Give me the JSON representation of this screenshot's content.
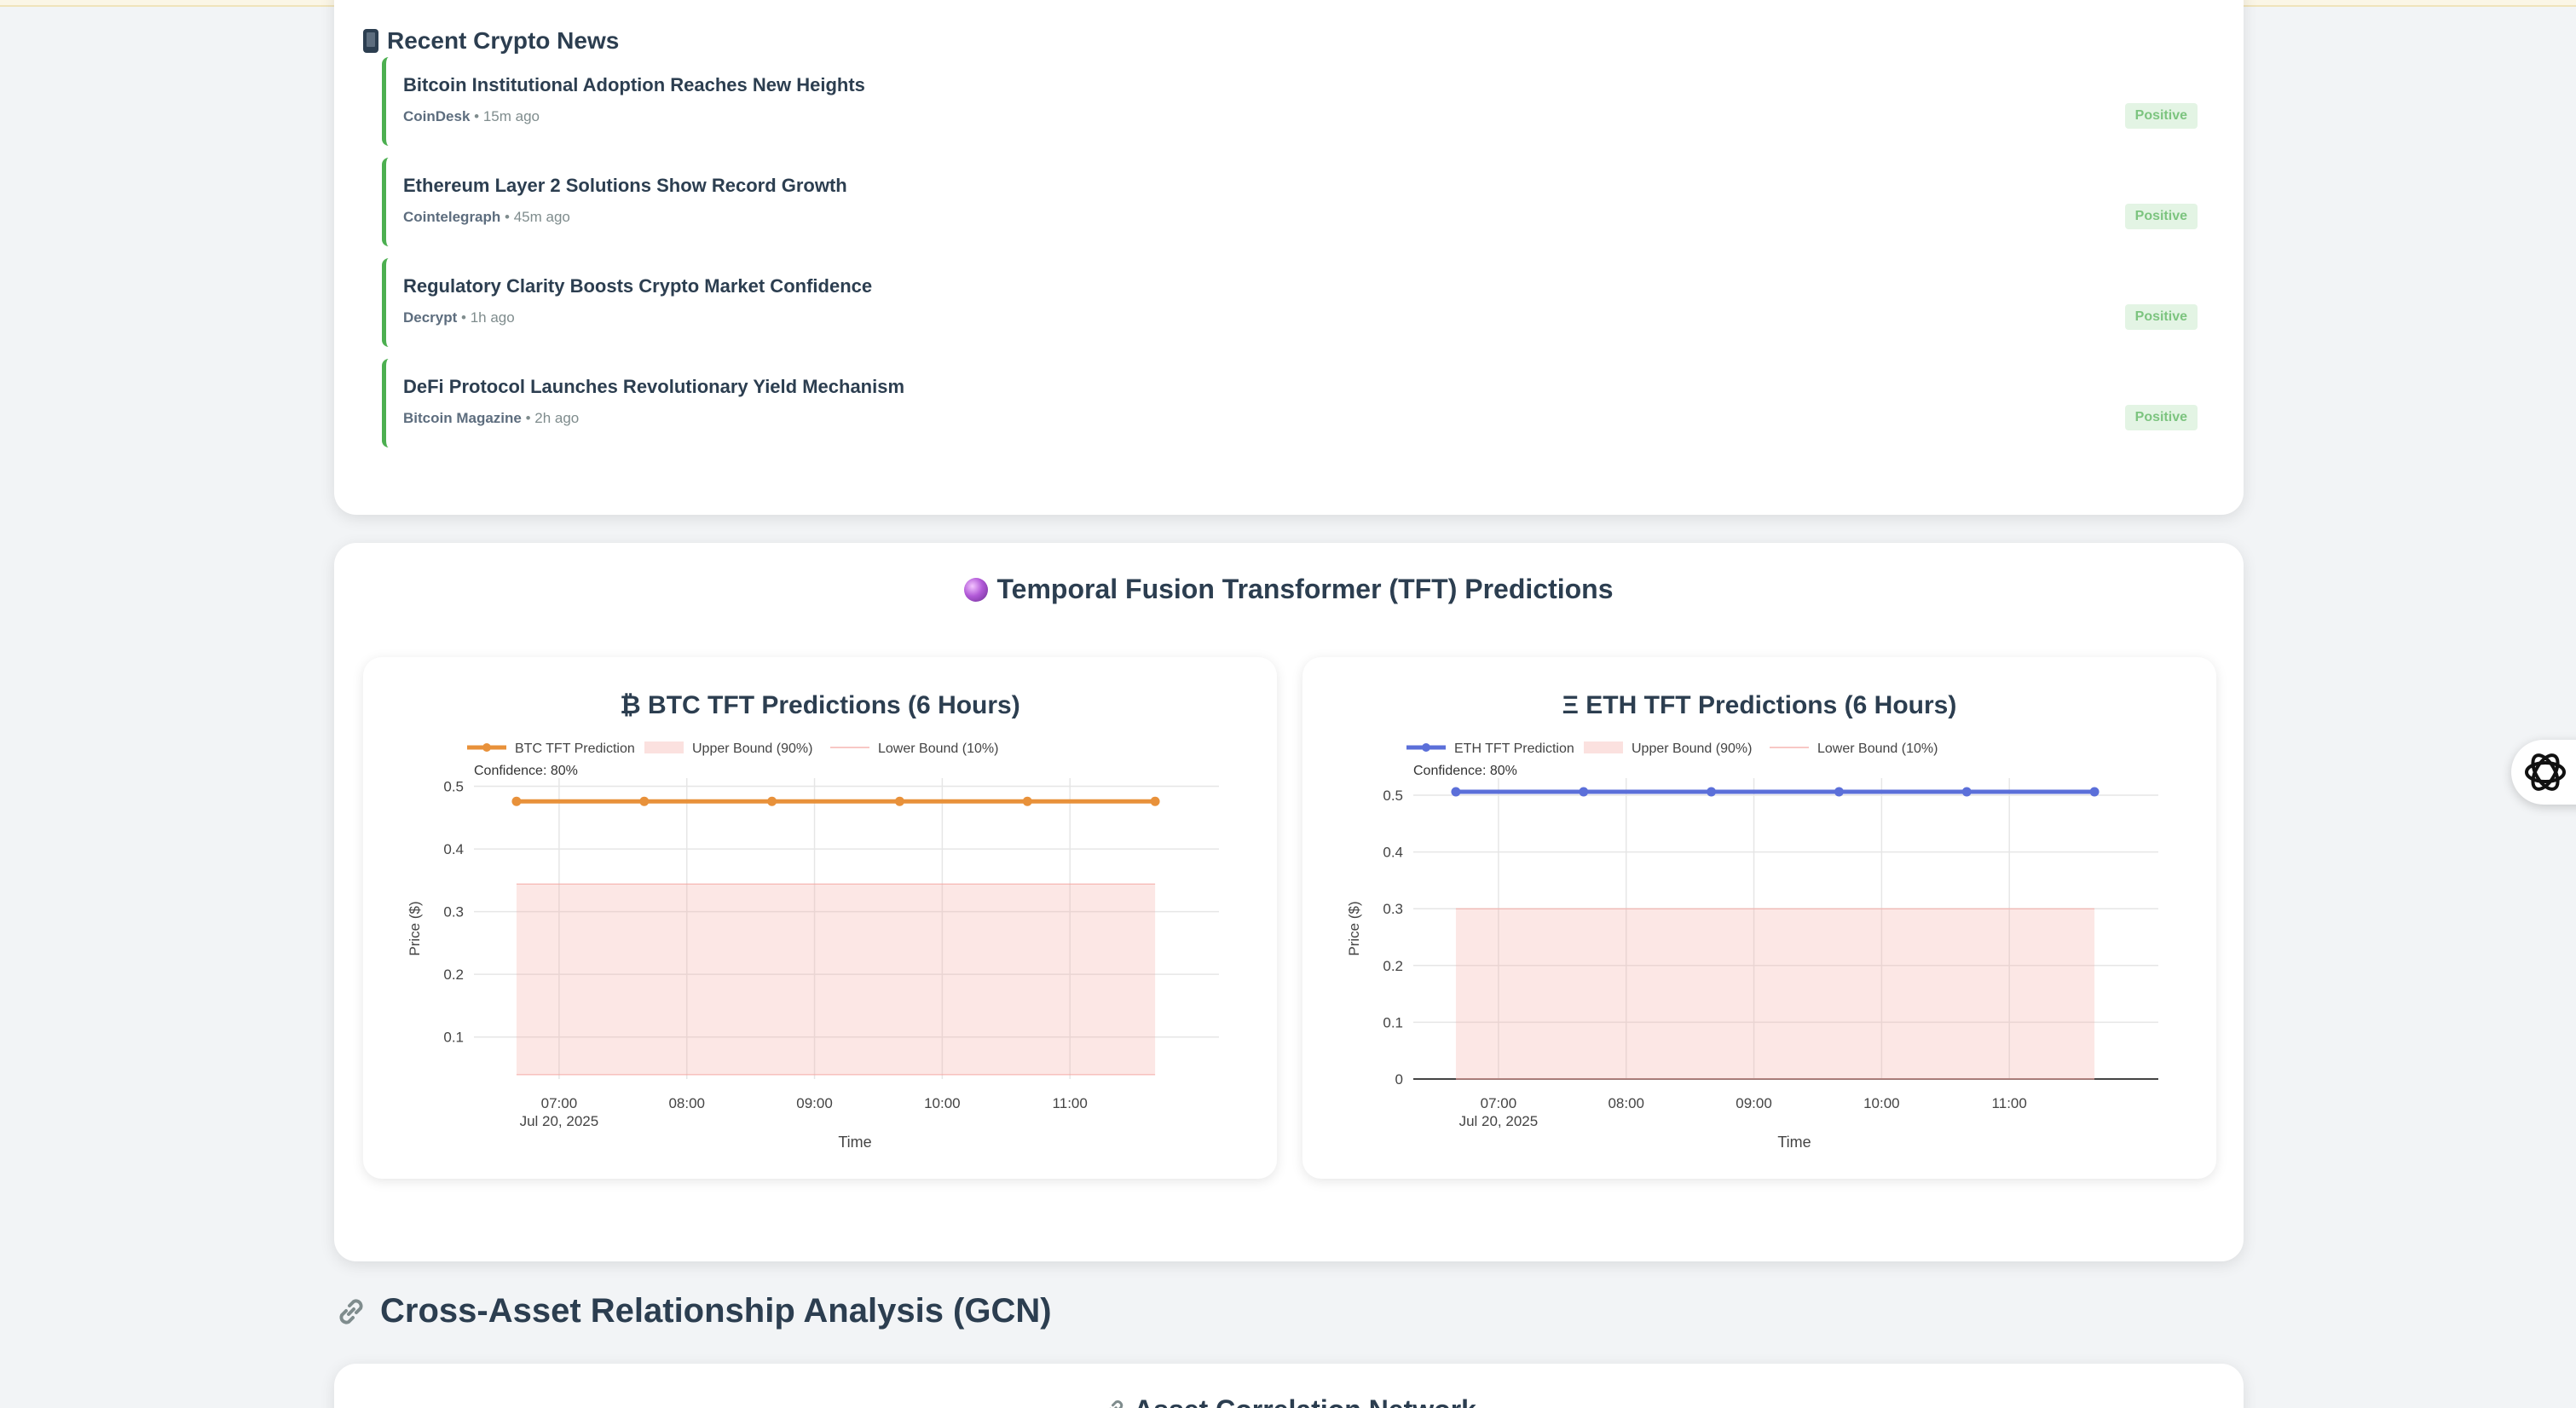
{
  "news": {
    "title": "Recent Crypto News",
    "icon": "phone-icon",
    "accent_color": "#4caf50",
    "items": [
      {
        "headline": "Bitcoin Institutional Adoption Reaches New Heights",
        "source": "CoinDesk",
        "time": "15m ago",
        "sentiment": "Positive"
      },
      {
        "headline": "Ethereum Layer 2 Solutions Show Record Growth",
        "source": "Cointelegraph",
        "time": "45m ago",
        "sentiment": "Positive"
      },
      {
        "headline": "Regulatory Clarity Boosts Crypto Market Confidence",
        "source": "Decrypt",
        "time": "1h ago",
        "sentiment": "Positive"
      },
      {
        "headline": "DeFi Protocol Launches Revolutionary Yield Mechanism",
        "source": "Bitcoin Magazine",
        "time": "2h ago",
        "sentiment": "Positive"
      }
    ]
  },
  "tft": {
    "title": "Temporal Fusion Transformer (TFT) Predictions",
    "icon": "crystal-ball-icon"
  },
  "chart_data": [
    {
      "type": "line",
      "title": "₿ BTC TFT Predictions (6 Hours)",
      "xlabel": "Time",
      "ylabel": "Price ($)",
      "x": [
        "06:40",
        "07:40",
        "08:40",
        "09:40",
        "10:40",
        "11:40"
      ],
      "x_ticks": [
        "07:00",
        "08:00",
        "09:00",
        "10:00",
        "11:00"
      ],
      "x_tick_sub": "Jul 20, 2025",
      "x_range_minutes": [
        -40,
        310
      ],
      "y_ticks": [
        "0.1",
        "0.2",
        "0.3",
        "0.4",
        "0.5"
      ],
      "ylim": [
        0.033,
        0.513
      ],
      "series": [
        {
          "name": "BTC TFT Prediction",
          "values": [
            0.476,
            0.476,
            0.476,
            0.476,
            0.476,
            0.476
          ],
          "color": "#e8913a"
        },
        {
          "name": "Upper Bound (90%)",
          "values": [
            0.344,
            0.344,
            0.344,
            0.344,
            0.344,
            0.344
          ],
          "color": "#f4a8a2"
        },
        {
          "name": "Lower Bound (10%)",
          "values": [
            0.04,
            0.04,
            0.04,
            0.04,
            0.04,
            0.04
          ],
          "color": "#f4a8a2"
        }
      ],
      "annotation": "Confidence: 80%",
      "legend": "top-left",
      "grid": true
    },
    {
      "type": "line",
      "title": "Ξ ETH TFT Predictions (6 Hours)",
      "xlabel": "Time",
      "ylabel": "Price ($)",
      "x": [
        "06:40",
        "07:40",
        "08:40",
        "09:40",
        "10:40",
        "11:40"
      ],
      "x_ticks": [
        "07:00",
        "08:00",
        "09:00",
        "10:00",
        "11:00"
      ],
      "x_tick_sub": "Jul 20, 2025",
      "x_range_minutes": [
        -40,
        310
      ],
      "y_ticks": [
        "0",
        "0.1",
        "0.2",
        "0.3",
        "0.4",
        "0.5"
      ],
      "ylim": [
        0,
        0.53
      ],
      "series": [
        {
          "name": "ETH TFT Prediction",
          "values": [
            0.506,
            0.506,
            0.506,
            0.506,
            0.506,
            0.506
          ],
          "color": "#5b6fd9"
        },
        {
          "name": "Upper Bound (90%)",
          "values": [
            0.3,
            0.3,
            0.3,
            0.3,
            0.3,
            0.3
          ],
          "color": "#f4a8a2"
        },
        {
          "name": "Lower Bound (10%)",
          "values": [
            0,
            0,
            0,
            0,
            0,
            0
          ],
          "color": "#f4a8a2"
        }
      ],
      "annotation": "Confidence: 80%",
      "legend": "top-left",
      "grid": true
    }
  ],
  "gcn": {
    "heading": "Cross-Asset Relationship Analysis (GCN)",
    "heading_icon": "link-icon",
    "network_title": "Asset Correlation Network",
    "network_icon": "link-icon"
  },
  "fab": {
    "icon": "openai-logo-icon"
  }
}
